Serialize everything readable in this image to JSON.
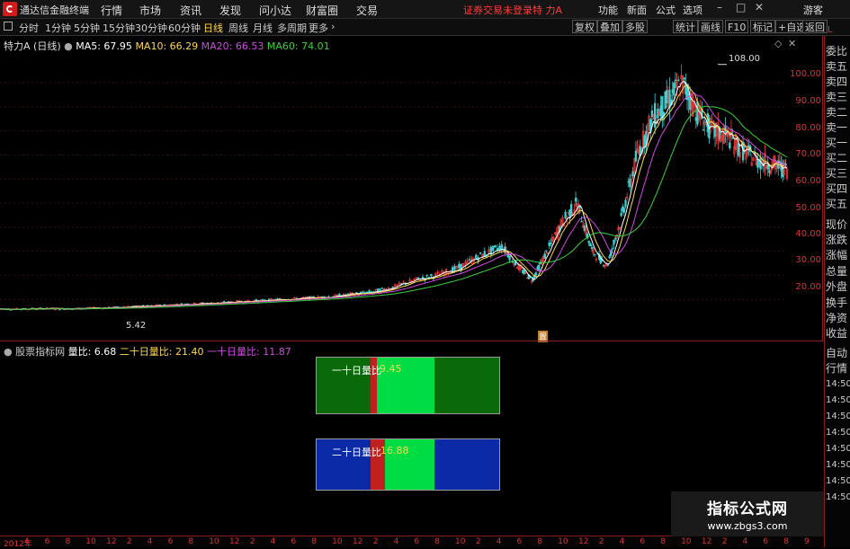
{
  "app": {
    "title": "通达信金融终端",
    "menus": [
      "行情",
      "市场",
      "资讯",
      "发现",
      "问小达",
      "财富圈",
      "交易"
    ],
    "login_warning": "证券交易未登录",
    "stock_name": "特 力A",
    "right_menus": [
      "功能",
      "新面",
      "公式",
      "选项"
    ],
    "user": "游客"
  },
  "toolbar": {
    "periods": [
      "分时",
      "1分钟",
      "5分钟",
      "15分钟",
      "30分钟",
      "60分钟",
      "日线",
      "周线",
      "月线",
      "多周期",
      "更多"
    ],
    "active_period": "日线",
    "buttons": [
      "复权",
      "叠加",
      "多股",
      "统计",
      "画线",
      "F10",
      "标记",
      "+自选",
      "返回"
    ]
  },
  "indicators": {
    "main_title": "特力A (日线)",
    "ma5": "MA5: 67.95",
    "ma10": "MA10: 66.29",
    "ma20": "MA20: 66.53",
    "ma60": "MA60: 74.01",
    "lower_title": "股票指标网",
    "vol_ratio": "量比: 6.68",
    "ratio20": "二十日量比: 21.40",
    "ratio10": "一十日量比: 11.87"
  },
  "chart": {
    "high_label": "108.00",
    "low_label": "5.42",
    "marker": "置",
    "y_ticks": [
      "100.00",
      "90.00",
      "80.00",
      "70.00",
      "60.00",
      "50.00",
      "40.00",
      "30.00",
      "20.00"
    ],
    "box_top_label": "一十日量比",
    "box_top_value": "9.45",
    "box_bottom_label": "二十日量比",
    "box_bottom_value": "16.88"
  },
  "chart_data": {
    "type": "candlestick",
    "title": "特力A (日线)",
    "ylim": [
      0,
      112
    ],
    "high": 108.0,
    "low": 5.42,
    "close_path": [
      6,
      6,
      6.2,
      6.1,
      6.3,
      6.5,
      7,
      7.2,
      7.8,
      8.2,
      8.5,
      9,
      9.5,
      10,
      10.5,
      11,
      12,
      13,
      15,
      18,
      20,
      23,
      28,
      32,
      24,
      18,
      30,
      42,
      50,
      30,
      24,
      45,
      70,
      85,
      92,
      100,
      88,
      80,
      78,
      72,
      68,
      66,
      64
    ]
  },
  "sidebar": {
    "items": [
      "委比",
      "卖五",
      "卖四",
      "卖三",
      "卖二",
      "卖一",
      "买一",
      "买二",
      "买三",
      "买四",
      "买五",
      "现价",
      "涨跌",
      "涨幅",
      "总量",
      "外盘",
      "换手",
      "净资",
      "收益",
      "自动",
      "行情",
      "14:50",
      "14:50",
      "14:50",
      "14:50",
      "14:50",
      "14:50",
      "14:50",
      "14:50"
    ]
  },
  "x_axis": {
    "labels": [
      "2012年",
      "4",
      "6",
      "8",
      "10",
      "12",
      "2",
      "4",
      "6",
      "8",
      "10",
      "12",
      "2",
      "4",
      "6",
      "8",
      "10",
      "12",
      "2",
      "4",
      "6",
      "8",
      "10",
      "2",
      "4",
      "6",
      "8",
      "10",
      "12",
      "2",
      "4",
      "6",
      "8",
      "10",
      "12",
      "2",
      "4",
      "6",
      "8",
      "9"
    ]
  },
  "watermark": {
    "line1": "指标公式网",
    "line2": "www.zbgs3.com"
  },
  "colors": {
    "ma5": "#ffffff",
    "ma10": "#ffd84a",
    "ma20": "#d048e0",
    "ma60": "#3ad13a",
    "axis": "#dd3333",
    "up": "#ff4040",
    "down": "#3fd1d1"
  }
}
